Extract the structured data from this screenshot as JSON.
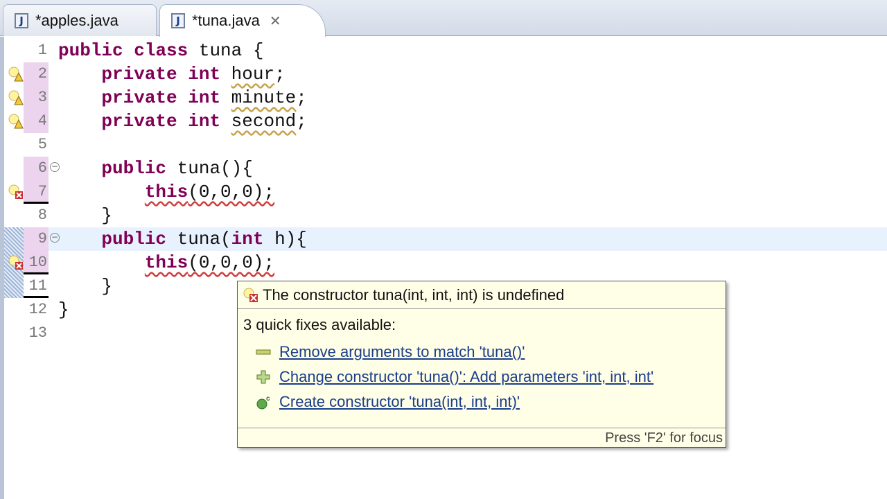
{
  "tabs": [
    {
      "label": "*apples.java",
      "active": false
    },
    {
      "label": "*tuna.java",
      "active": true
    }
  ],
  "lines": [
    {
      "n": "1"
    },
    {
      "n": "2"
    },
    {
      "n": "3"
    },
    {
      "n": "4"
    },
    {
      "n": "5"
    },
    {
      "n": "6"
    },
    {
      "n": "7"
    },
    {
      "n": "8"
    },
    {
      "n": "9"
    },
    {
      "n": "10"
    },
    {
      "n": "11"
    },
    {
      "n": "12"
    },
    {
      "n": "13"
    }
  ],
  "code": {
    "public": "public",
    "class": "class",
    "private": "private",
    "int": "int",
    "this": "this",
    "l1": " tuna {",
    "hour": "hour",
    "minute": "minute",
    "second": "second",
    "semi": ";",
    "l6": " tuna(){",
    "call": "(0,0,0);",
    "close": "}",
    "l9a": " tuna(",
    "l9b": " h){"
  },
  "tooltip": {
    "title": "The constructor tuna(int, int, int) is undefined",
    "subtitle": "3 quick fixes available:",
    "fixes": [
      {
        "label": "Remove arguments to match 'tuna()'",
        "icon": "remove-icon"
      },
      {
        "label": "Change constructor 'tuna()': Add parameters 'int, int, int'",
        "icon": "add-icon"
      },
      {
        "label": "Create constructor 'tuna(int, int, int)'",
        "icon": "constructor-icon"
      }
    ],
    "footer": "Press 'F2' for focus"
  }
}
